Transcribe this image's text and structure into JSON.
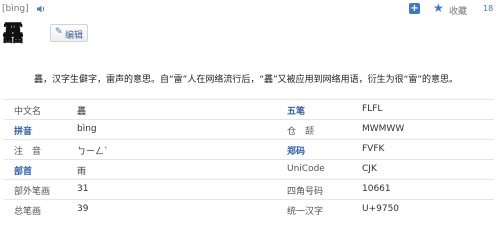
{
  "header": {
    "pronunciation": "[bìng]",
    "speaker_icon": "speaker-icon",
    "add_icon": "+",
    "star_icon": "★",
    "favorite_label": "收藏",
    "count": "18"
  },
  "entry": {
    "character": "靐",
    "edit_label": "编辑",
    "edit_icon": "✎"
  },
  "description": "靐，汉字生僻字，雷声的意思。自“雷”人在网络流行后，“靐”又被应用到网络用语，衍生为很“雷”的意思。",
  "info_rows": [
    {
      "left_label": "中文名",
      "left_value": "靐",
      "right_label": "五笔",
      "right_value": "FLFL",
      "right_link": true,
      "left_link": false
    },
    {
      "left_label": "拼音",
      "left_value": "bìng",
      "right_label": "仓　颉",
      "right_value": "MWMWW",
      "right_link": false,
      "left_link": true
    },
    {
      "left_label": "注　音",
      "left_value": "ㄅㄧㄥˋ",
      "right_label": "郑码",
      "right_value": "FVFK",
      "right_link": true,
      "left_link": false
    },
    {
      "left_label": "部首",
      "left_value": "雨",
      "right_label": "UniCode",
      "right_value": "CJK",
      "right_link": false,
      "left_link": true
    },
    {
      "left_label": "部外笔画",
      "left_value": "31",
      "right_label": "四角号码",
      "right_value": "10661",
      "right_link": false,
      "left_link": false
    },
    {
      "left_label": "总笔画",
      "left_value": "39",
      "right_label": "统一汉字",
      "right_value": "U+9750",
      "right_link": false,
      "left_link": false
    }
  ]
}
